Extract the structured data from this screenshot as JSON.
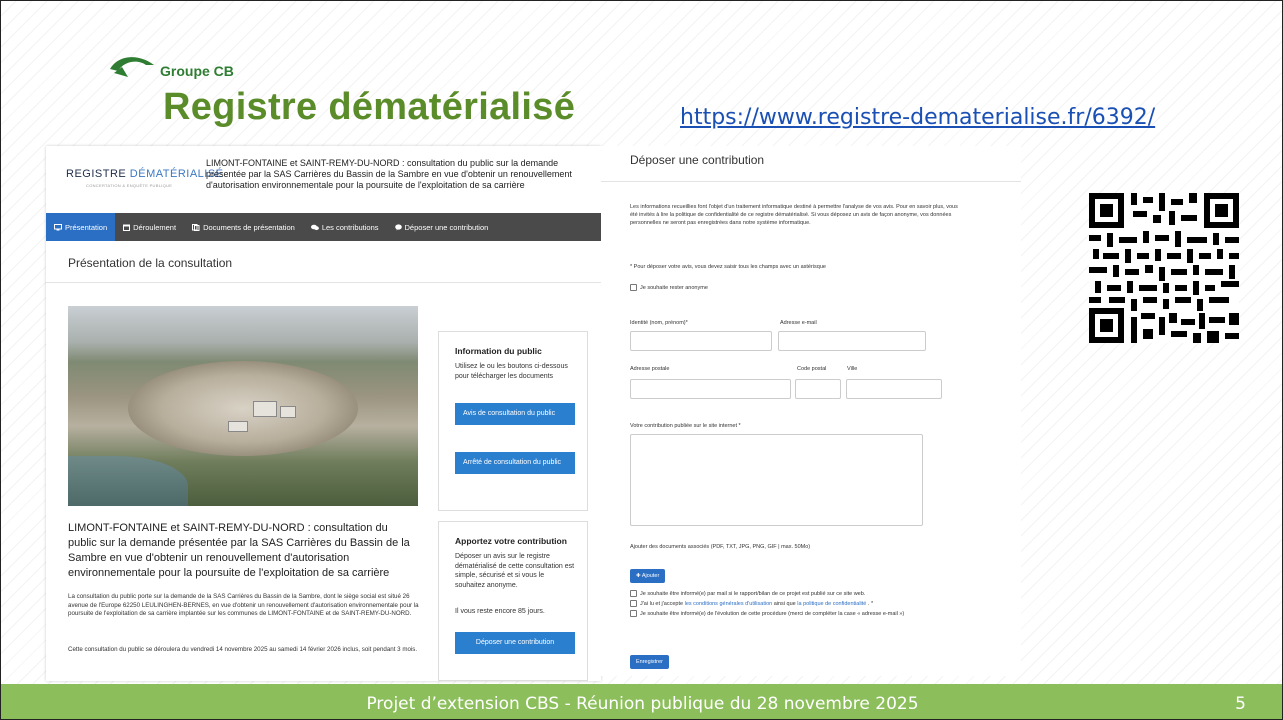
{
  "logo": {
    "text": "Groupe CB"
  },
  "title": "Registre dématérialisé",
  "url": "https://www.registre-dematerialise.fr/6392/",
  "left": {
    "reg_logo_a": "REGISTRE ",
    "reg_logo_b": "DÉMATÉRIALISÉ",
    "reg_logo_sub": "CONCERTATION & ENQUÊTE PUBLIQUE",
    "reg_desc": "LIMONT-FONTAINE et SAINT-REMY-DU-NORD : consultation du public sur la demande présentée par la SAS Carrières du Bassin de la Sambre en vue d'obtenir un renouvellement d'autorisation environnementale pour la poursuite de l'exploitation de sa carrière",
    "nav": [
      {
        "label": "Présentation",
        "icon": "monitor-icon"
      },
      {
        "label": "Déroulement",
        "icon": "calendar-icon"
      },
      {
        "label": "Documents de présentation",
        "icon": "documents-icon"
      },
      {
        "label": "Les contributions",
        "icon": "comments-icon"
      },
      {
        "label": "Déposer une contribution",
        "icon": "comment-icon"
      }
    ],
    "pres_title": "Présentation de la consultation",
    "info_h": "Information du public",
    "info_t": "Utilisez le ou les boutons ci-dessous pour télécharger les documents",
    "btn_avis": "Avis de consultation du public",
    "btn_arrete": "Arrêté de consultation du public",
    "contrib_h": "Apportez votre contribution",
    "contrib_t": "Déposer un avis sur le registre dématérialisé de cette consultation est simple, sécurisé et si vous le souhaitez anonyme.",
    "contrib_days": "Il vous reste encore 85 jours.",
    "btn_deposer": "Déposer une contribution",
    "main_h": "LIMONT-FONTAINE et SAINT-REMY-DU-NORD : consultation du public sur la demande présentée par la SAS Carrières du Bassin de la Sambre en vue d'obtenir un renouvellement d'autorisation environnementale pour la poursuite de l'exploitation de sa carrière",
    "main_p1": "La consultation du public porte sur la demande de la SAS Carrières du Bassin de la Sambre, dont le siège social est situé 26 avenue de l'Europe 62250 LEULINGHEN-BERNES, en vue d'obtenir un renouvellement d'autorisation environnementale pour la poursuite de l'exploitation de sa carrière implantée sur les communes de LIMONT-FONTAINE et de SAINT-REMY-DU-NORD.",
    "main_p2": "Cette consultation du public se déroulera du vendredi 14 novembre 2025 au samedi 14 février 2026 inclus, soit pendant 3 mois."
  },
  "right": {
    "h": "Déposer une contribution",
    "intro": "Les informations recueillies font l'objet d'un traitement informatique destiné à permettre l'analyse de vos avis. Pour en savoir plus, vous été invités à lire la politique de confidentialité de ce registre dématérialisé. Si vous déposez un avis de façon anonyme, vos données personnelles ne seront pas enregistrées dans notre système informatique.",
    "required_note": "* Pour déposer votre avis, vous devez saisir tous les champs avec un astérisque",
    "anon": "Je souhaite rester anonyme",
    "identity_label": "Identité (nom, prénom)*",
    "email_label": "Adresse e-mail",
    "address_label": "Adresse postale",
    "postal_label": "Code postal",
    "city_label": "Ville",
    "contribution_label": "Votre contribution publiée sur le site internet *",
    "attach_label": "Ajouter des documents associés (PDF, TXT, JPG, PNG, GIF | max. 50Mo)",
    "add_btn": "Ajouter",
    "cb1": "Je souhaite être informé(e) par mail si le rapport/bilan de ce projet est publié sur ce site web.",
    "cb2_a": "J'ai lu et j'accepte ",
    "cb2_link1": "les conditions générales d'utilisation",
    "cb2_b": " ainsi que ",
    "cb2_link2": "la politique de confidentialité",
    "cb2_c": " . *",
    "cb3": "Je souhaite être informé(e) de l'évolution de cette procédure (merci de compléter la case « adresse e-mail »)",
    "submit": "Enregistrer"
  },
  "footer": "Projet d’extension CBS - Réunion publique du 28 novembre 2025",
  "page_number": "5"
}
